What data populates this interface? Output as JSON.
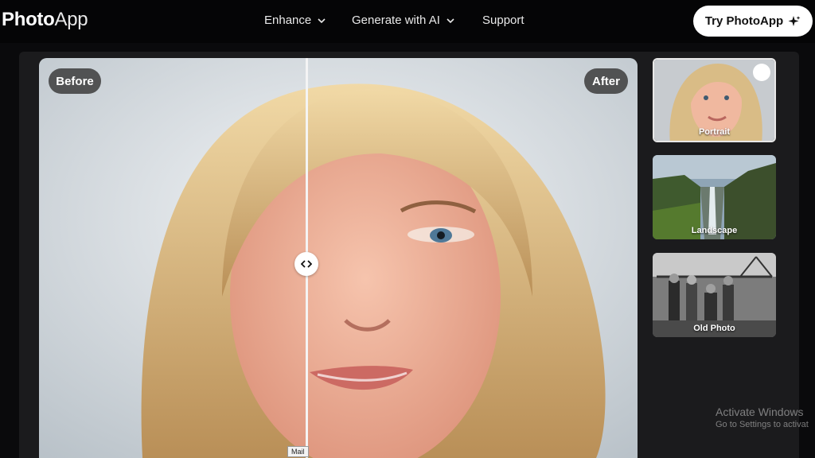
{
  "header": {
    "logo_bold": "Photo",
    "logo_thin": "App",
    "nav": [
      {
        "label": "Enhance",
        "icon": "chevron-down-icon"
      },
      {
        "label": "Generate with AI",
        "icon": "chevron-down-icon"
      },
      {
        "label": "Support"
      }
    ],
    "cta_label": "Try PhotoApp",
    "cta_icon": "sparkle-icon"
  },
  "viewer": {
    "before_label": "Before",
    "after_label": "After",
    "handle_icon": "code-arrows-icon",
    "tooltip": "Mail"
  },
  "samples": [
    {
      "label": "Portrait",
      "selected": true,
      "icon": "check-icon"
    },
    {
      "label": "Landscape",
      "selected": false
    },
    {
      "label": "Old Photo",
      "selected": false
    }
  ],
  "watermark": {
    "line1": "Activate Windows",
    "line2": "Go to Settings to activat"
  },
  "colors": {
    "background": "#0a0a0c",
    "panel": "#1b1b1d",
    "cta_bg": "#ffffff",
    "pill_bg": "#3c3c3c"
  }
}
